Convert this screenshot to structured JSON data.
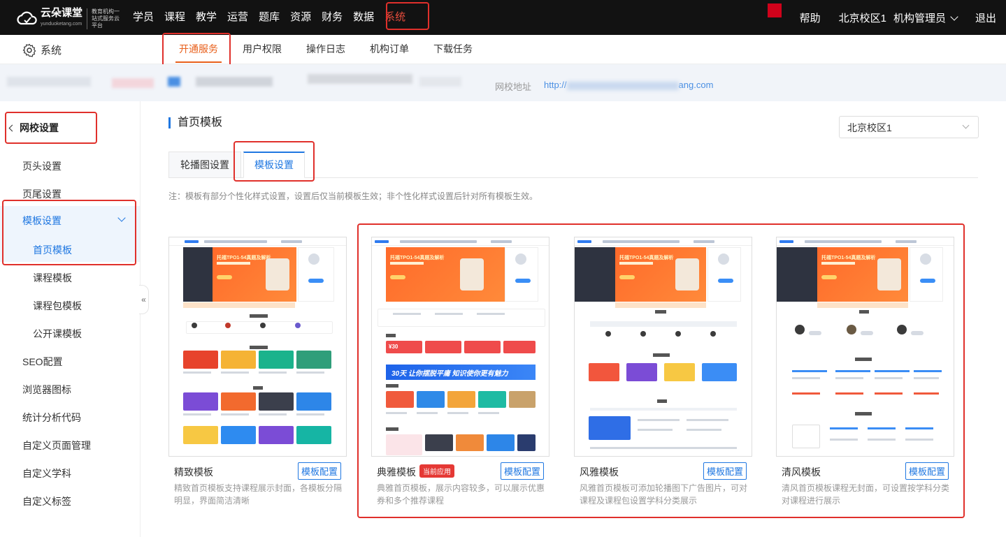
{
  "topbar": {
    "brand": "云朵课堂",
    "brand_sub": "yunduoketang.com",
    "slogan": "教育机构一站式服务云平台",
    "nav": [
      "学员",
      "课程",
      "教学",
      "运营",
      "题库",
      "资源",
      "财务",
      "数据",
      "系统"
    ],
    "active_nav": "系统",
    "help": "帮助",
    "campus": "北京校区1",
    "role": "机构管理员",
    "logout": "退出"
  },
  "subbar": {
    "title": "系统",
    "tabs": [
      "开通服务",
      "用户权限",
      "操作日志",
      "机构订单",
      "下载任务"
    ],
    "active_tab": "开通服务"
  },
  "banner": {
    "label": "网校地址",
    "url_start": "http://",
    "url_end": "ang.com"
  },
  "sidebar": {
    "back_label": "网校设置",
    "items_top": [
      "页头设置",
      "页尾设置"
    ],
    "group_label": "模板设置",
    "sub_items": [
      "首页模板",
      "课程模板",
      "课程包模板",
      "公开课模板"
    ],
    "active_sub": "首页模板",
    "items_bottom": [
      "SEO配置",
      "浏览器图标",
      "统计分析代码",
      "自定义页面管理",
      "自定义学科",
      "自定义标签"
    ],
    "collapse": "«"
  },
  "main": {
    "page_title": "首页模板",
    "campus_select": "北京校区1",
    "tabs": [
      "轮播图设置",
      "模板设置"
    ],
    "active_tab": "模板设置",
    "note": "注：模板有部分个性化样式设置，设置后仅当前模板生效；非个性化样式设置后针对所有模板生效。",
    "config_label": "模板配置",
    "current_badge": "当前应用",
    "thumb_text": {
      "hero": "托福TPO1-54真题及解析",
      "banner": "30天 让你摆脱平庸 知识使你更有魅力",
      "coupon": "¥30"
    },
    "templates": [
      {
        "name": "精致模板",
        "desc": "精致首页模板支持课程展示封面，各模板分隔明显，界面简洁清晰",
        "current": false
      },
      {
        "name": "典雅模板",
        "desc": "典雅首页模板，展示内容较多，可以展示优惠券和多个推荐课程",
        "current": true
      },
      {
        "name": "风雅模板",
        "desc": "风雅首页模板可添加轮播图下广告图片，可对课程及课程包设置学科分类展示",
        "current": false
      },
      {
        "name": "清风模板",
        "desc": "清风首页模板课程无封面，可设置按学科分类对课程进行展示",
        "current": false
      }
    ]
  },
  "colors": {
    "accent_blue": "#1f77e1",
    "orange": "#e8601c",
    "highlight_red": "#e0302b",
    "topbar_bg": "#121212"
  }
}
